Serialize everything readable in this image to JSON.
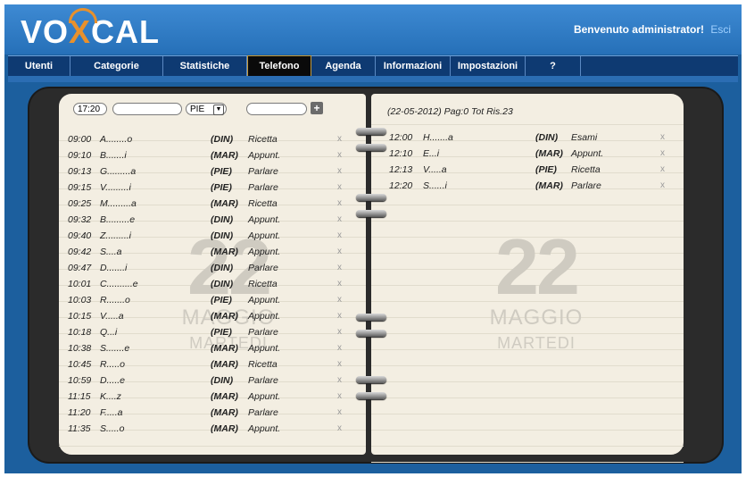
{
  "app": {
    "logo": {
      "pre": "VO",
      "x": "X",
      "post": "CAL"
    },
    "welcome_text": "Benvenuto administrator!",
    "logout_label": "Esci"
  },
  "nav": [
    {
      "label": "Utenti"
    },
    {
      "label": "Categorie"
    },
    {
      "label": "Statistiche"
    },
    {
      "label": "Telefono"
    },
    {
      "label": "Agenda"
    },
    {
      "label": "Informazioni"
    },
    {
      "label": "Impostazioni"
    },
    {
      "label": "?"
    }
  ],
  "active_tab": "Telefono",
  "form": {
    "time_value": "17:20",
    "name_value": "",
    "location_value": "PIE",
    "note_value": "",
    "add_icon": "plus-icon"
  },
  "right_header": "(22-05-2012) Pag:0 Tot Ris.23",
  "date_display": {
    "day_number": "22",
    "month": "MAGGIO",
    "weekday": "MARTEDI"
  },
  "left_entries": [
    {
      "time": "09:00",
      "name": "A........o",
      "location": "(DIN)",
      "type": "Ricetta"
    },
    {
      "time": "09:10",
      "name": "B.......i",
      "location": "(MAR)",
      "type": "Appunt."
    },
    {
      "time": "09:13",
      "name": "G.........a",
      "location": "(PIE)",
      "type": "Parlare"
    },
    {
      "time": "09:15",
      "name": "V.........i",
      "location": "(PIE)",
      "type": "Parlare"
    },
    {
      "time": "09:25",
      "name": "M.........a",
      "location": "(MAR)",
      "type": "Ricetta"
    },
    {
      "time": "09:32",
      "name": "B.........e",
      "location": "(DIN)",
      "type": "Appunt."
    },
    {
      "time": "09:40",
      "name": "Z.........i",
      "location": "(DIN)",
      "type": "Appunt."
    },
    {
      "time": "09:42",
      "name": "S....a",
      "location": "(MAR)",
      "type": "Appunt."
    },
    {
      "time": "09:47",
      "name": "D.......i",
      "location": "(DIN)",
      "type": "Parlare"
    },
    {
      "time": "10:01",
      "name": "C..........e",
      "location": "(DIN)",
      "type": "Ricetta"
    },
    {
      "time": "10:03",
      "name": "R.......o",
      "location": "(PIE)",
      "type": "Appunt."
    },
    {
      "time": "10:15",
      "name": "V.....a",
      "location": "(MAR)",
      "type": "Appunt."
    },
    {
      "time": "10:18",
      "name": "Q...i",
      "location": "(PIE)",
      "type": "Parlare"
    },
    {
      "time": "10:38",
      "name": "S.......e",
      "location": "(MAR)",
      "type": "Appunt."
    },
    {
      "time": "10:45",
      "name": "R.....o",
      "location": "(MAR)",
      "type": "Ricetta"
    },
    {
      "time": "10:59",
      "name": "D.....e",
      "location": "(DIN)",
      "type": "Parlare"
    },
    {
      "time": "11:15",
      "name": "K....z",
      "location": "(MAR)",
      "type": "Appunt."
    },
    {
      "time": "11:20",
      "name": "F.....a",
      "location": "(MAR)",
      "type": "Parlare"
    },
    {
      "time": "11:35",
      "name": "S.....o",
      "location": "(MAR)",
      "type": "Appunt."
    }
  ],
  "right_entries": [
    {
      "time": "12:00",
      "name": "H.......a",
      "location": "(DIN)",
      "type": "Esami"
    },
    {
      "time": "12:10",
      "name": "E...i",
      "location": "(MAR)",
      "type": "Appunt."
    },
    {
      "time": "12:13",
      "name": "V.....a",
      "location": "(PIE)",
      "type": "Ricetta"
    },
    {
      "time": "12:20",
      "name": "S......i",
      "location": "(MAR)",
      "type": "Parlare"
    }
  ],
  "delete_glyph": "x"
}
